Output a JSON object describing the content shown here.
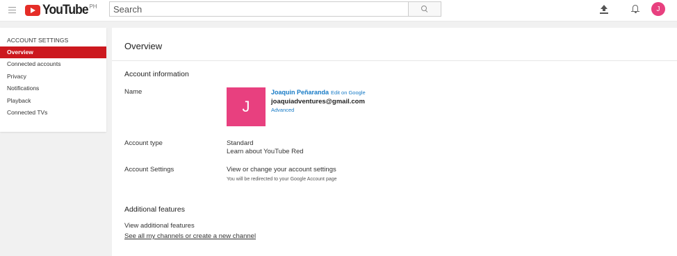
{
  "header": {
    "logo_text": "YouTube",
    "country_code": "PH",
    "search_placeholder": "Search",
    "avatar_initial": "J"
  },
  "sidebar": {
    "title": "ACCOUNT SETTINGS",
    "items": [
      {
        "label": "Overview",
        "active": true
      },
      {
        "label": "Connected accounts",
        "active": false
      },
      {
        "label": "Privacy",
        "active": false
      },
      {
        "label": "Notifications",
        "active": false
      },
      {
        "label": "Playback",
        "active": false
      },
      {
        "label": "Connected TVs",
        "active": false
      }
    ]
  },
  "main": {
    "page_title": "Overview",
    "account_information": {
      "title": "Account information",
      "name_label": "Name",
      "avatar_initial": "J",
      "name": "Joaquin Peñaranda",
      "edit_label": "Edit on Google",
      "email": "joaquiadventures@gmail.com",
      "advanced_label": "Advanced",
      "account_type_label": "Account type",
      "account_type_value": "Standard",
      "learn_red_label": "Learn about YouTube Red",
      "account_settings_label": "Account Settings",
      "account_settings_link": "View or change your account settings",
      "redirect_note": "You will be redirected to your Google Account page"
    },
    "additional_features": {
      "title": "Additional features",
      "view_link": "View additional features",
      "channels_link": "See all my channels or create a new channel"
    }
  },
  "colors": {
    "brand_red": "#cc181e",
    "link_blue": "#167ac6",
    "avatar_pink": "#e8407f"
  }
}
